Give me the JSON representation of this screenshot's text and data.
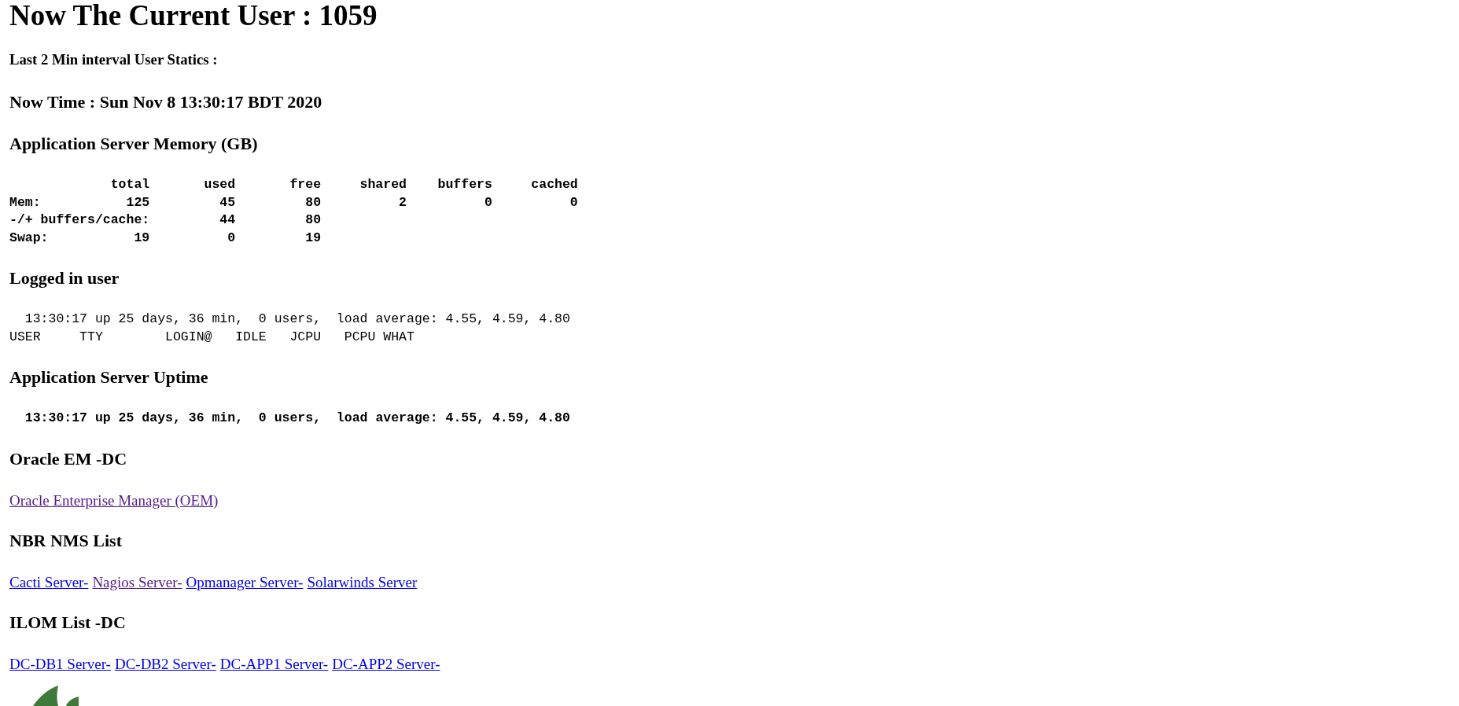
{
  "title": "Now The Current User : 1059",
  "subtitle": "Last 2 Min interval User Statics :",
  "now_time": "Now Time : Sun Nov 8 13:30:17 BDT 2020",
  "sections": [
    {
      "heading": "Application Server Memory (GB)",
      "kind": "table",
      "columns": [
        "total",
        "used",
        "free",
        "shared",
        "buffers",
        "cached"
      ],
      "rows": [
        {
          "label": "Mem:",
          "cells": [
            "125",
            "45",
            "80",
            "2",
            "0",
            "0"
          ]
        },
        {
          "label": "-/+ buffers/cache:",
          "cells": [
            null,
            "44",
            "80"
          ]
        },
        {
          "label": "Swap:",
          "cells": [
            "19",
            "0",
            "19"
          ]
        }
      ]
    },
    {
      "heading": "Logged in user",
      "kind": "console",
      "bold": false,
      "lines": [
        "  13:30:17 up 25 days, 36 min,  0 users,  load average: 4.55, 4.59, 4.80",
        "USER     TTY        LOGIN@   IDLE   JCPU   PCPU WHAT"
      ]
    },
    {
      "heading": "Application Server Uptime",
      "kind": "console",
      "bold": true,
      "lines": [
        "  13:30:17 up 25 days, 36 min,  0 users,  load average: 4.55, 4.59, 4.80"
      ]
    },
    {
      "heading": "Oracle EM -DC",
      "kind": "links",
      "links": [
        {
          "label": "Oracle Enterprise Manager (OEM)",
          "visited": true
        }
      ]
    },
    {
      "heading": "NBR NMS List",
      "kind": "links",
      "links": [
        {
          "label": "Cacti Server-",
          "visited": false
        },
        {
          "label": "Nagios Server-",
          "visited": true
        },
        {
          "label": "Opmanager Server-",
          "visited": false
        },
        {
          "label": "Solarwinds Server",
          "visited": false
        }
      ]
    },
    {
      "heading": "ILOM List -DC",
      "kind": "links",
      "links": [
        {
          "label": "DC-DB1 Server-",
          "visited": false
        },
        {
          "label": "DC-DB2 Server-",
          "visited": false
        },
        {
          "label": "DC-APP1 Server-",
          "visited": false
        },
        {
          "label": "DC-APP2 Server-",
          "visited": false
        }
      ]
    }
  ]
}
